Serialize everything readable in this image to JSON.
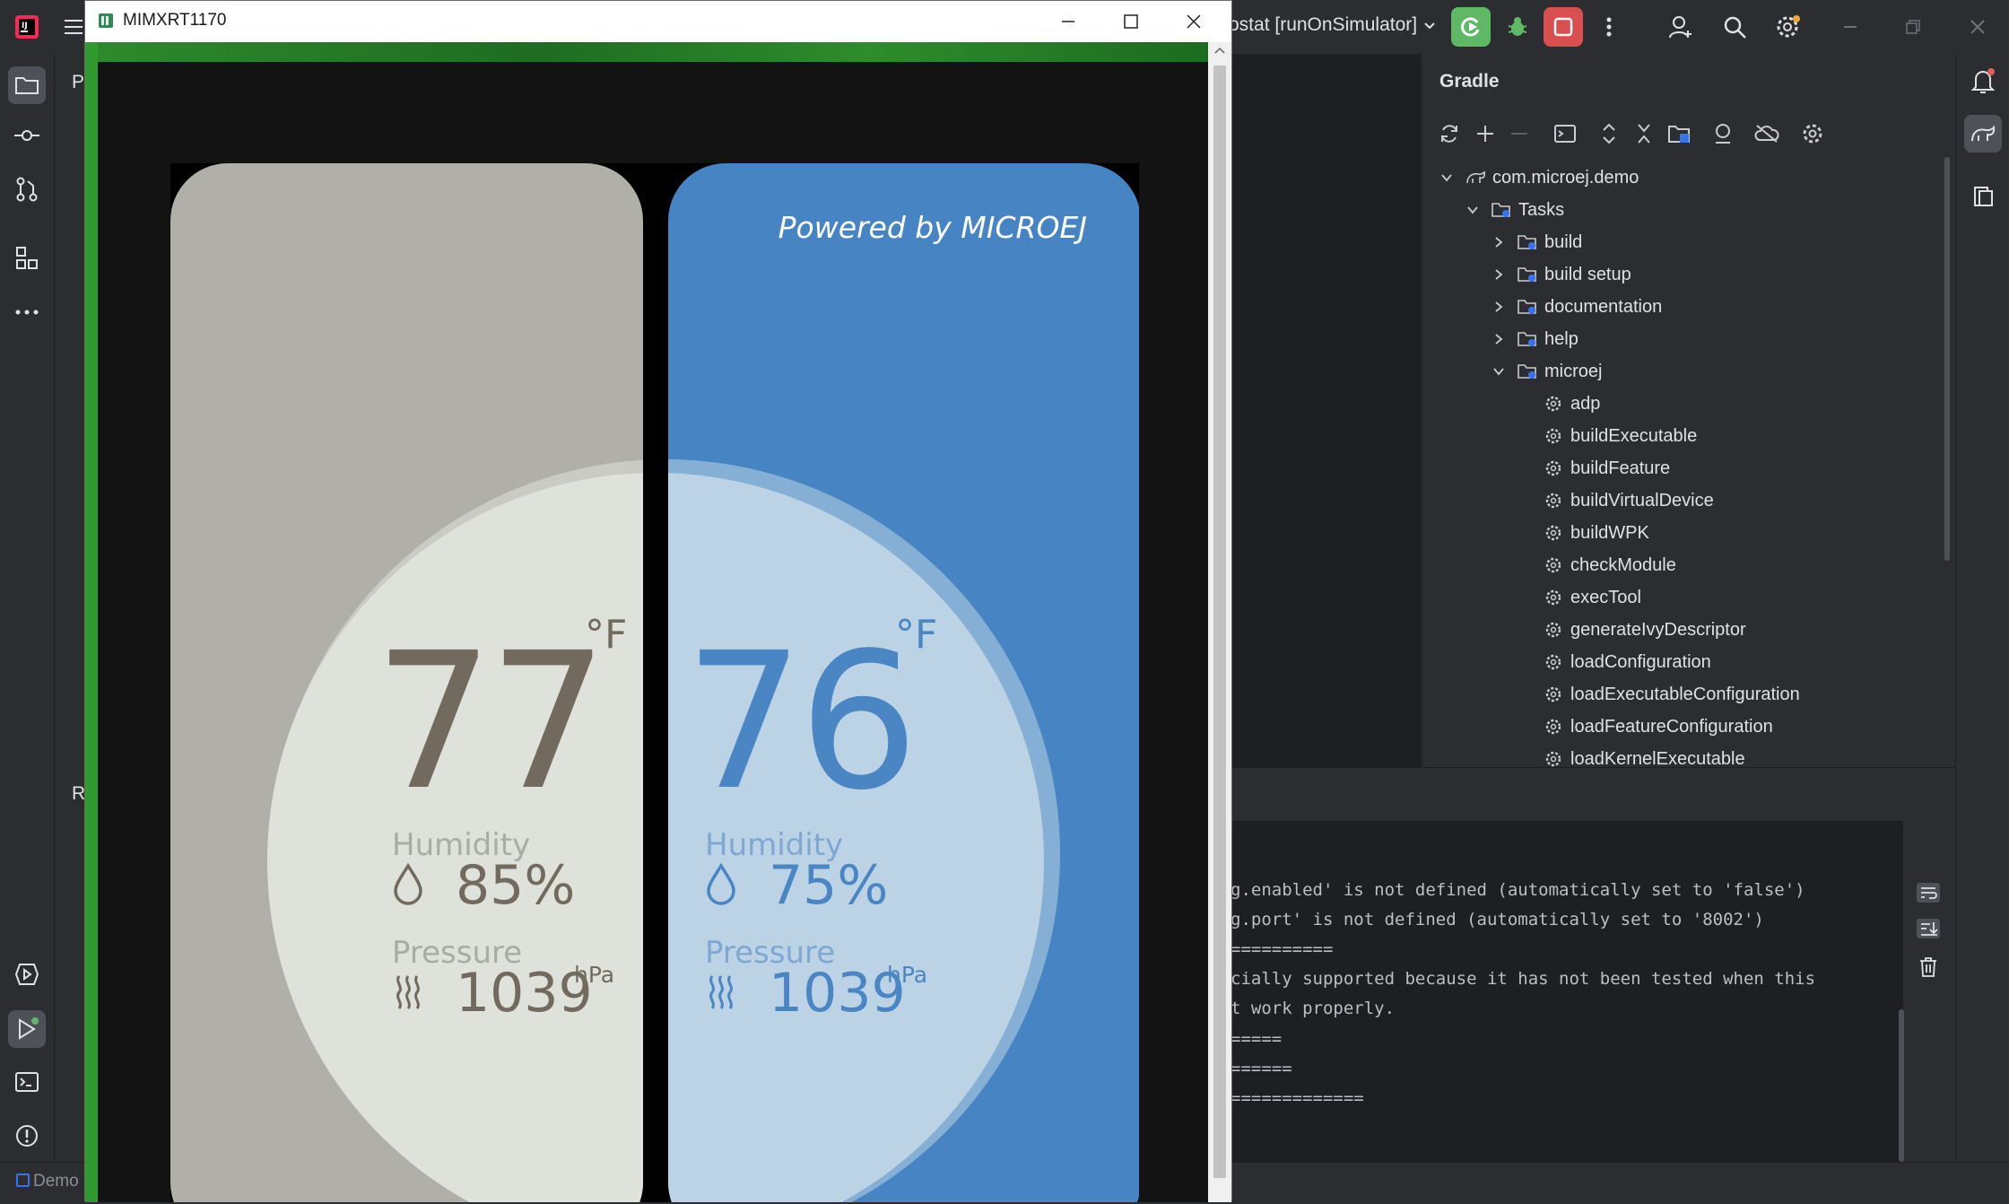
{
  "ide": {
    "run_config": "ostat [runOnSimulator]",
    "project_label": "P",
    "run_label": "R",
    "status_project": "Demo"
  },
  "gradle": {
    "title": "Gradle",
    "tree": [
      {
        "label": "com.microej.demo",
        "depth": 0,
        "expanded": true,
        "kind": "project"
      },
      {
        "label": "Tasks",
        "depth": 1,
        "expanded": true,
        "kind": "folder"
      },
      {
        "label": "build",
        "depth": 2,
        "expanded": false,
        "kind": "folder"
      },
      {
        "label": "build setup",
        "depth": 2,
        "expanded": false,
        "kind": "folder"
      },
      {
        "label": "documentation",
        "depth": 2,
        "expanded": false,
        "kind": "folder"
      },
      {
        "label": "help",
        "depth": 2,
        "expanded": false,
        "kind": "folder"
      },
      {
        "label": "microej",
        "depth": 2,
        "expanded": true,
        "kind": "folder"
      },
      {
        "label": "adp",
        "depth": 3,
        "kind": "task"
      },
      {
        "label": "buildExecutable",
        "depth": 3,
        "kind": "task"
      },
      {
        "label": "buildFeature",
        "depth": 3,
        "kind": "task"
      },
      {
        "label": "buildVirtualDevice",
        "depth": 3,
        "kind": "task"
      },
      {
        "label": "buildWPK",
        "depth": 3,
        "kind": "task"
      },
      {
        "label": "checkModule",
        "depth": 3,
        "kind": "task"
      },
      {
        "label": "execTool",
        "depth": 3,
        "kind": "task"
      },
      {
        "label": "generateIvyDescriptor",
        "depth": 3,
        "kind": "task"
      },
      {
        "label": "loadConfiguration",
        "depth": 3,
        "kind": "task"
      },
      {
        "label": "loadExecutableConfiguration",
        "depth": 3,
        "kind": "task"
      },
      {
        "label": "loadFeatureConfiguration",
        "depth": 3,
        "kind": "task"
      },
      {
        "label": "loadKernelExecutable",
        "depth": 3,
        "kind": "task"
      }
    ]
  },
  "console": {
    "lines": [
      "g.enabled' is not defined (automatically set to 'false')",
      "g.port' is not defined (automatically set to '8002')",
      "==========",
      "cially supported because it has not been tested when this",
      "t work properly.",
      "=====",
      "======",
      "============="
    ]
  },
  "simulator": {
    "window_title": "MIMXRT1170",
    "powered_by": "Powered by MICROEJ",
    "left_panel": {
      "temperature": "77",
      "unit": "°F",
      "humidity_label": "Humidity",
      "humidity_value": "85%",
      "pressure_label": "Pressure",
      "pressure_value": "1039",
      "pressure_unit": "hPa",
      "bg_color": "#b0afa8",
      "circle_color": "#dfe2db",
      "text_color": "#726a5e",
      "label_color": "#a9aca6"
    },
    "right_panel": {
      "temperature": "76",
      "unit": "°F",
      "humidity_label": "Humidity",
      "humidity_value": "75%",
      "pressure_label": "Pressure",
      "pressure_value": "1039",
      "pressure_unit": "hPa",
      "bg_color": "#4684c4",
      "circle_color": "#bcd3e6",
      "text_color": "#4a85c4",
      "label_color": "#7ea8d3"
    }
  },
  "colors": {
    "ide_bg": "#2b2d30",
    "editor_bg": "#1e1f22",
    "run_green": "#5fb865",
    "stop_red": "#d94f4f"
  }
}
